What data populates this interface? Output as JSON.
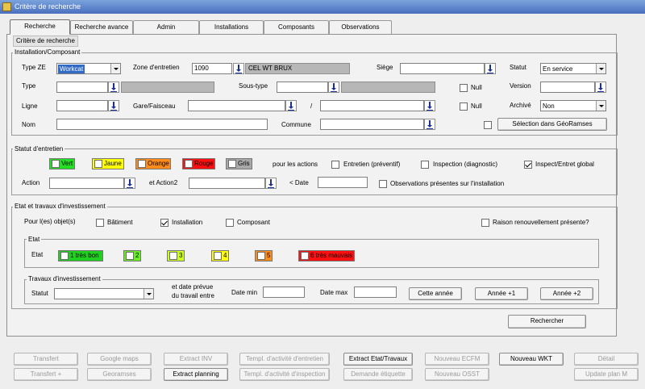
{
  "window": {
    "title": "Critère de recherche"
  },
  "tabs": [
    "Recherche",
    "Recherche avance",
    "Admin",
    "Installations",
    "Composants",
    "Observations"
  ],
  "section_title": "Critère de recherche",
  "installation": {
    "group_title": "Installation/Composant",
    "type_ze_label": "Type ZE",
    "type_ze_value": "Workcat",
    "zone_label": "Zone d'entretien",
    "zone_code": "1090",
    "zone_name": "CEL WT BRUX",
    "siege_label": "Siège",
    "statut_label": "Statut",
    "statut_value": "En service",
    "type_label": "Type",
    "soustype_label": "Sous-type",
    "null_label": "Null",
    "version_label": "Version",
    "ligne_label": "Ligne",
    "gare_label": "Gare/Faisceau",
    "slash": "/",
    "null2_label": "Null",
    "archive_label": "Archivé",
    "archive_value": "Non",
    "nom_label": "Nom",
    "commune_label": "Commune",
    "georamses_button": "Sélection dans GéoRamses"
  },
  "statut_entretien": {
    "group_title": "Statut d'entretien",
    "colors": [
      {
        "label": "Vert",
        "color": "#22e022"
      },
      {
        "label": "Jaune",
        "color": "#ffff00"
      },
      {
        "label": "Orange",
        "color": "#ff8c1a"
      },
      {
        "label": "Rouge",
        "color": "#ff1010"
      },
      {
        "label": "Gris",
        "color": "#a8a8a8"
      }
    ],
    "pour_actions": "pour les actions",
    "entretien": "Entretien (préventif)",
    "inspection": "Inspection (diagnostic)",
    "inspect_global": "Inspect/Entret global",
    "action_label": "Action",
    "action2_label": "et Action2",
    "date_label": "< Date",
    "observations": "Observations présentes sur l'installation"
  },
  "etat_travaux": {
    "group_title": "Etat et travaux d'investissement",
    "pour_objets": "Pour l(es) objet(s)",
    "batiment": "Bâtiment",
    "installation": "Installation",
    "composant": "Composant",
    "raison": "Raison renouvellement présente?",
    "etat_group": "Etat",
    "etat_label": "Etat",
    "etat_levels": [
      {
        "label": "1 très bon",
        "color": "#1fd01f"
      },
      {
        "label": "2",
        "color": "#66ee22"
      },
      {
        "label": "3",
        "color": "#ccff22"
      },
      {
        "label": "4",
        "color": "#ffff00"
      },
      {
        "label": "5",
        "color": "#ff8c1a"
      },
      {
        "label": "6 très mauvais",
        "color": "#ff1010"
      }
    ],
    "travaux_group": "Travaux d'investissement",
    "statut_label": "Statut",
    "date_prevue_1": "et date prévue",
    "date_prevue_2": "du travail entre",
    "date_min": "Date min",
    "date_max": "Date max",
    "cette_annee": "Cette année",
    "annee_plus1": "Année +1",
    "annee_plus2": "Année +2"
  },
  "rechercher": "Rechercher",
  "bottom_row1": [
    "Transfert",
    "Google maps",
    "Extract INV",
    "Templ. d'activité d'entretien",
    "Extract Etat/Travaux",
    "Nouveau ECFM",
    "Nouveau WKT",
    "Détail"
  ],
  "bottom_row2": [
    "Transfert +",
    "Georamses",
    "Extract planning",
    "Templ. d'activité d'inspection",
    "Demande étiquette",
    "Nouveau OSST",
    "Update plan M"
  ]
}
